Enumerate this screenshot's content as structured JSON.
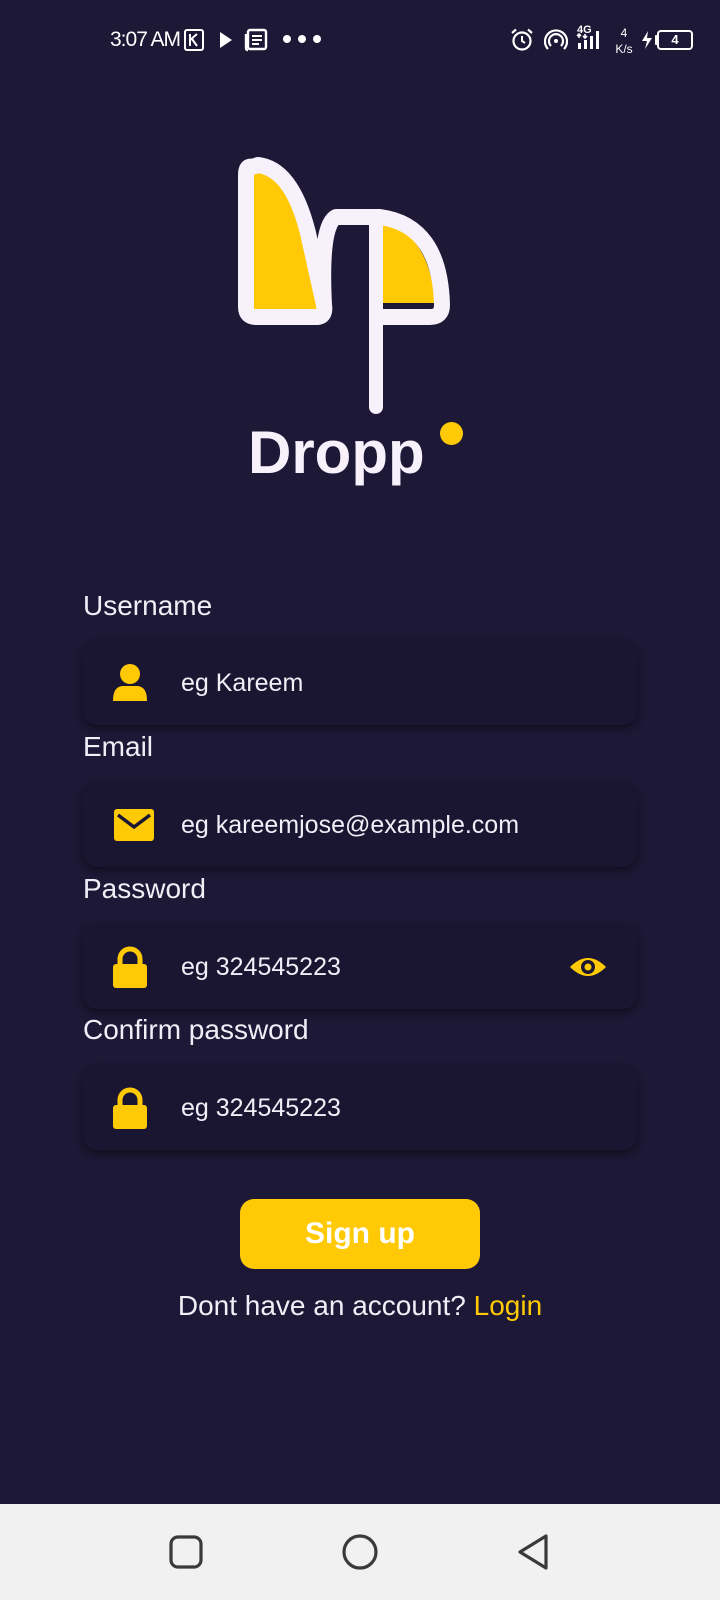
{
  "status_bar": {
    "time": "3:07 AM",
    "network_type": "4G",
    "speed_value": "4",
    "speed_unit": "K/s",
    "battery": "4"
  },
  "brand": {
    "name": "Dropp",
    "primary_color": "#ffc905",
    "background_color": "#1c1835"
  },
  "form": {
    "username": {
      "label": "Username",
      "placeholder": "eg Kareem",
      "icon": "user-icon"
    },
    "email": {
      "label": "Email",
      "placeholder": "eg kareemjose@example.com",
      "icon": "mail-icon"
    },
    "password": {
      "label": "Password",
      "placeholder": "eg 324545223",
      "icon": "lock-icon"
    },
    "confirm_password": {
      "label": "Confirm password",
      "placeholder": "eg 324545223",
      "icon": "lock-icon"
    }
  },
  "actions": {
    "signup_label": "Sign up",
    "account_prompt": "Dont have an account?",
    "login_label": "Login"
  },
  "nav": {
    "icons": [
      "recent-apps-icon",
      "home-icon",
      "back-icon"
    ]
  }
}
